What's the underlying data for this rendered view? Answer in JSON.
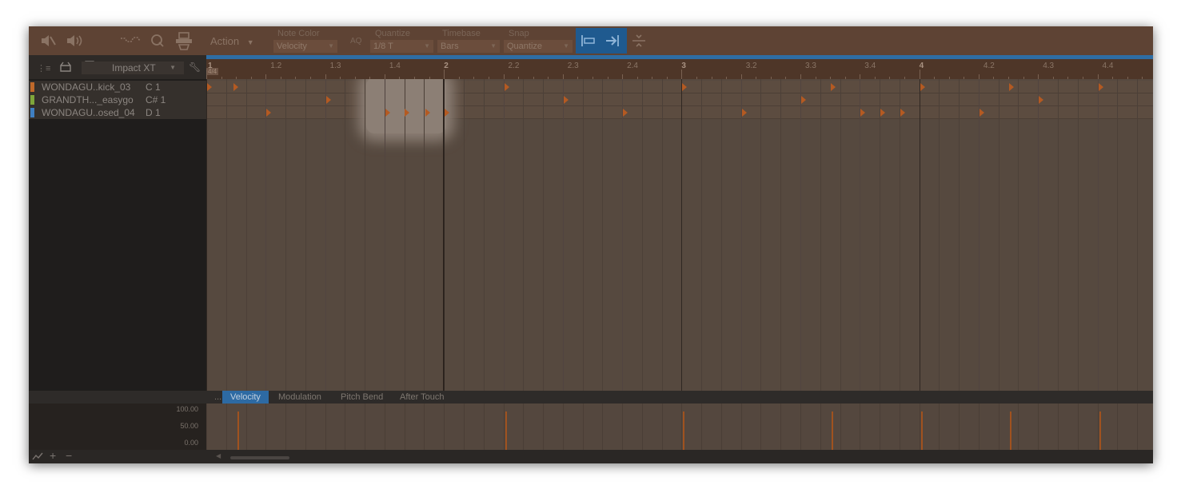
{
  "toolbar": {
    "mute_icon": "speaker-mute-icon",
    "listen_icon": "speaker-icon",
    "action_label": "Action",
    "note_color": {
      "label": "Note Color",
      "value": "Velocity"
    },
    "aq_label": "AQ",
    "quantize": {
      "label": "Quantize",
      "value": "1/8 T"
    },
    "timebase": {
      "label": "Timebase",
      "value": "Bars"
    },
    "snap": {
      "label": "Snap",
      "value": "Quantize"
    }
  },
  "instrument": {
    "name": "Impact XT"
  },
  "time_signature": "4/4",
  "ruler": {
    "labels": [
      "1",
      "1.2",
      "1.3",
      "1.4",
      "2",
      "2.2",
      "2.3",
      "2.4",
      "3",
      "3.2",
      "3.3",
      "3.4",
      "4",
      "4.2",
      "4.3",
      "4.4"
    ]
  },
  "tracks": [
    {
      "name": "WONDAGU..kick_03",
      "note": "C 1",
      "color": "#c0692a"
    },
    {
      "name": "GRANDTH..._easygo",
      "note": "C# 1",
      "color": "#7fa63a"
    },
    {
      "name": "WONDAGU..osed_04",
      "note": "D 1",
      "color": "#3f7fc2"
    }
  ],
  "notes": [
    {
      "track": 0,
      "beats": [
        0.0,
        0.45,
        5.0,
        8.0,
        10.5,
        12.0,
        13.5,
        15.0
      ]
    },
    {
      "track": 1,
      "beats": [
        2.0,
        6.0,
        10.0,
        14.0
      ]
    },
    {
      "track": 2,
      "beats": [
        1.0,
        3.0,
        3.33,
        3.67,
        4.0,
        7.0,
        9.0,
        11.0,
        11.33,
        11.67,
        13.0
      ]
    }
  ],
  "lower_tabs": [
    "...",
    "Velocity",
    "Modulation",
    "Pitch Bend",
    "After Touch"
  ],
  "velocity_axis": [
    "100.00",
    "50.00",
    "0.00"
  ],
  "velocity_bars": [
    {
      "beat": 0.5,
      "value": 0.82
    },
    {
      "beat": 5.0,
      "value": 0.82
    },
    {
      "beat": 8.0,
      "value": 0.82
    },
    {
      "beat": 10.5,
      "value": 0.82
    },
    {
      "beat": 12.0,
      "value": 0.82
    },
    {
      "beat": 13.5,
      "value": 0.82
    },
    {
      "beat": 15.0,
      "value": 0.82
    }
  ],
  "footer": {
    "icons": [
      "curve-icon",
      "plus-icon",
      "minus-icon"
    ]
  }
}
